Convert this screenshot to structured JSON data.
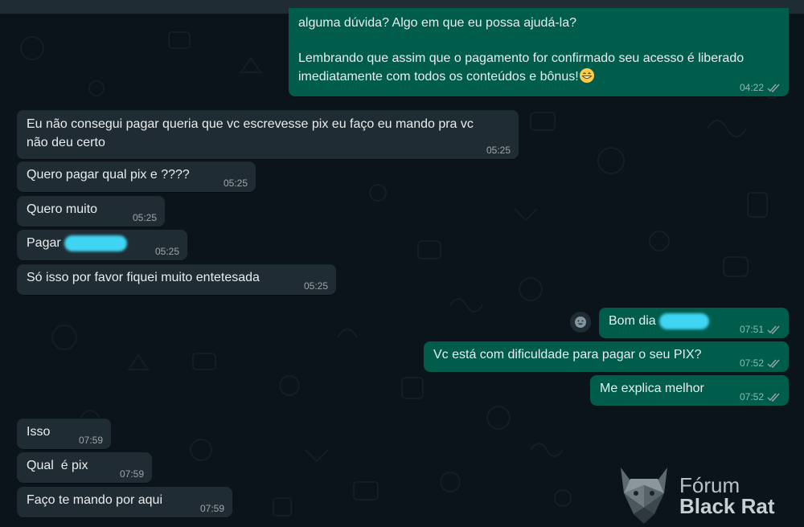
{
  "messages": {
    "m1": {
      "line1": "alguma dúvida? Algo em que eu possa ajudá-la?",
      "line2": "Lembrando que assim que o pagamento for confirmado seu acesso é liberado",
      "line3": "imediatamente com todos os conteúdos e bônus!",
      "time": "04:22"
    },
    "m2": {
      "text": "Eu não consegui pagar queria que vc escrevesse pix eu faço eu mando pra vc\nnão deu certo",
      "time": "05:25"
    },
    "m3": {
      "text": "Quero pagar qual pix e ????",
      "time": "05:25"
    },
    "m4": {
      "text": "Quero muito",
      "time": "05:25"
    },
    "m5": {
      "text": "Pagar",
      "time": "05:25"
    },
    "m6": {
      "text": "Só isso por favor fiquei muito entetesada",
      "time": "05:25"
    },
    "m7": {
      "text": "Bom dia",
      "time": "07:51"
    },
    "m8": {
      "text": "Vc está com dificuldade para pagar o seu PIX?",
      "time": "07:52"
    },
    "m9": {
      "text": "Me explica melhor",
      "time": "07:52"
    },
    "m10": {
      "text": "Isso",
      "time": "07:59"
    },
    "m11": {
      "text": "Qual  é pix",
      "time": "07:59"
    },
    "m12": {
      "text": "Faço te mando por aqui",
      "time": "07:59"
    }
  },
  "watermark": {
    "line1": "Fórum",
    "line2": "Black Rat"
  },
  "colors": {
    "background": "#0b141a",
    "incoming": "#202c33",
    "outgoing": "#005c4b",
    "redaction": "#3fd4f2"
  },
  "icons": {
    "ticks": "double-check-icon",
    "reaction": "emoji-reaction-icon",
    "emoji": "grinning-face-emoji"
  }
}
